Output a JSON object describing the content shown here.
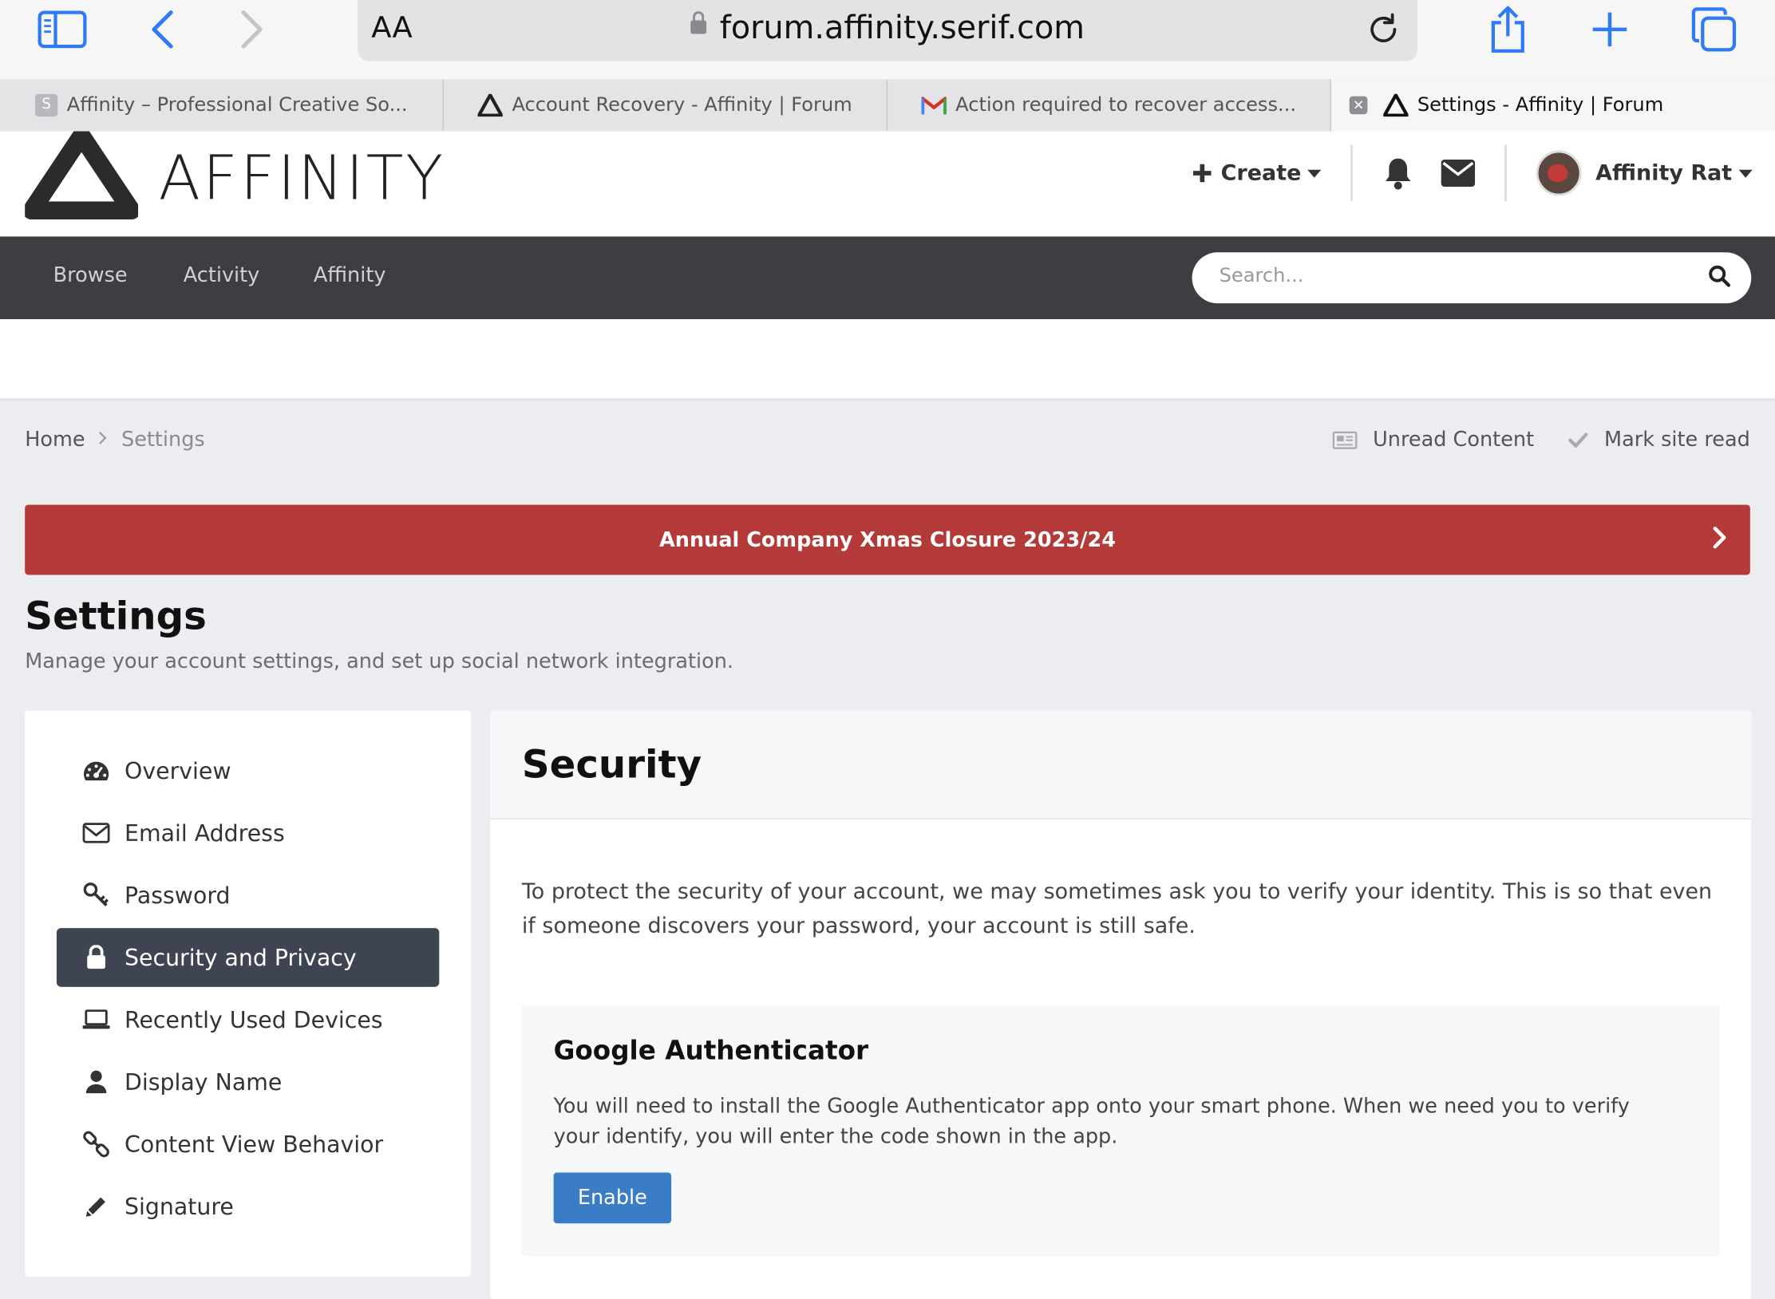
{
  "browser": {
    "url": "forum.affinity.serif.com",
    "reader_label": "AA",
    "tabs": [
      {
        "label": "Affinity – Professional Creative So..."
      },
      {
        "label": "Account Recovery - Affinity | Forum"
      },
      {
        "label": "Action required to recover access..."
      },
      {
        "label": "Settings - Affinity | Forum"
      }
    ],
    "tab_close_glyph": "✕",
    "favicon_letter": "S"
  },
  "header": {
    "logo_text": "AFFINITY",
    "create_label": "Create",
    "user_name": "Affinity Rat"
  },
  "nav": {
    "items": [
      "Browse",
      "Activity",
      "Affinity"
    ],
    "search_placeholder": "Search..."
  },
  "breadcrumb": {
    "home": "Home",
    "current": "Settings",
    "unread": "Unread Content",
    "mark_read": "Mark site read"
  },
  "announcement": {
    "text": "Annual Company Xmas Closure 2023/24",
    "color": "#b33a38"
  },
  "page": {
    "title": "Settings",
    "description": "Manage your account settings, and set up social network integration."
  },
  "sidebar": {
    "items": [
      {
        "label": "Overview",
        "icon": "dashboard-icon"
      },
      {
        "label": "Email Address",
        "icon": "envelope-icon"
      },
      {
        "label": "Password",
        "icon": "key-icon"
      },
      {
        "label": "Security and Privacy",
        "icon": "lock-icon",
        "active": true
      },
      {
        "label": "Recently Used Devices",
        "icon": "laptop-icon"
      },
      {
        "label": "Display Name",
        "icon": "user-icon"
      },
      {
        "label": "Content View Behavior",
        "icon": "link-icon"
      },
      {
        "label": "Signature",
        "icon": "pencil-icon"
      }
    ]
  },
  "main": {
    "title": "Security",
    "intro": "To protect the security of your account, we may sometimes ask you to verify your identity. This is so that even if someone discovers your password, your account is still safe.",
    "card": {
      "title": "Google Authenticator",
      "text": "You will need to install the Google Authenticator app onto your smart phone. When we need you to verify your identify, you will enter the code shown in the app.",
      "button": "Enable"
    }
  },
  "colors": {
    "accent": "#2f7bf5",
    "nav_bg": "#3d3d42",
    "active_item": "#3e4452",
    "button": "#3a7cc6"
  }
}
